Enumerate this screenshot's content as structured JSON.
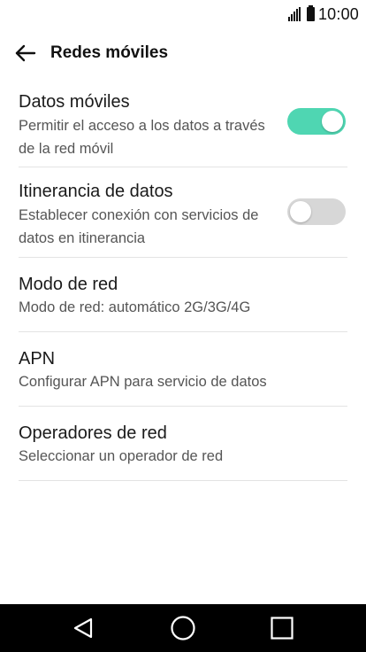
{
  "status_bar": {
    "time": "10:00",
    "signal_icon": "signal-bars-icon",
    "battery_icon": "battery-icon"
  },
  "header": {
    "back_icon": "arrow-left-icon",
    "title": "Redes móviles"
  },
  "settings": [
    {
      "title": "Datos móviles",
      "summary": "Permitir el acceso a los datos a través de la red móvil",
      "toggle": true
    },
    {
      "title": "Itinerancia de datos",
      "summary": "Establecer conexión con servicios de datos en itinerancia",
      "toggle": false
    },
    {
      "title": "Modo de red",
      "summary": "Modo de red: automático 2G/3G/4G"
    },
    {
      "title": "APN",
      "summary": "Configurar APN para servicio de datos"
    },
    {
      "title": "Operadores de red",
      "summary": "Seleccionar un operador de red"
    }
  ],
  "nav_bar": {
    "back_icon": "triangle-back-icon",
    "home_icon": "circle-home-icon",
    "recents_icon": "square-recents-icon"
  },
  "colors": {
    "toggle_on": "#4fd6b2",
    "toggle_off": "#d7d7d7",
    "nav_background": "#000000"
  }
}
